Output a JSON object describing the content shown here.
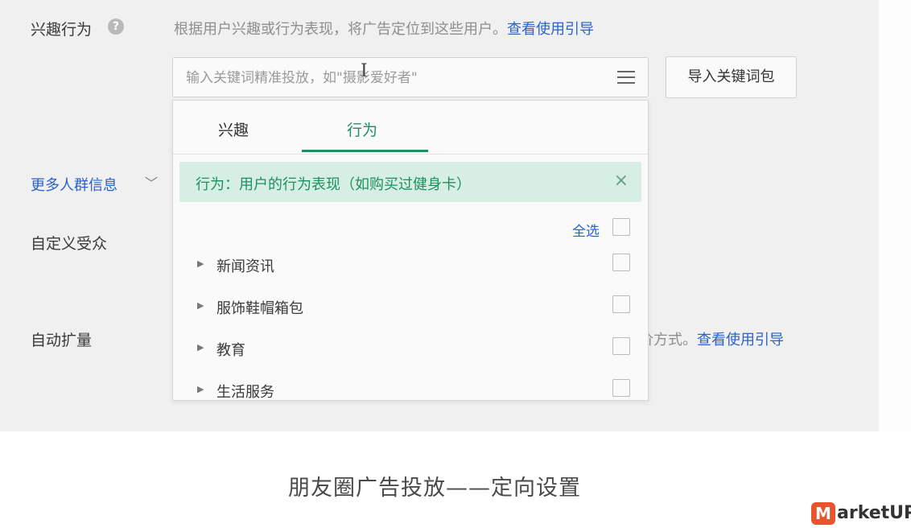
{
  "form": {
    "interest_label": "兴趣行为",
    "interest_hint": "根据用户兴趣或行为表现，将广告定位到这些用户。",
    "interest_hint_link": "查看使用引导",
    "search_placeholder": "输入关键词精准投放，如\"摄影爱好者\"",
    "import_button": "导入关键词包",
    "more_audience_link": "更多人群信息",
    "custom_audience_label": "自定义受众",
    "auto_expand_label": "自动扩量",
    "auto_expand_hint_partial": "价方式。",
    "auto_expand_hint_link": "查看使用引导"
  },
  "dropdown": {
    "tabs": [
      {
        "label": "兴趣"
      },
      {
        "label": "行为"
      }
    ],
    "active_tab": "行为",
    "notice_text": "行为：用户的行为表现（如购买过健身卡）",
    "notice_close": "×",
    "select_all_label": "全选",
    "categories": [
      {
        "label": "新闻资讯"
      },
      {
        "label": "服饰鞋帽箱包"
      },
      {
        "label": "教育"
      },
      {
        "label": "生活服务"
      }
    ]
  },
  "caption": "朋友圈广告投放——定向设置",
  "watermark": {
    "mark": "M",
    "text": "arketUP",
    "color": "#e8542e"
  },
  "colors": {
    "accent_green": "#1e8f63",
    "link_blue": "#2a62c8",
    "notice_bg": "#d7efe3"
  }
}
